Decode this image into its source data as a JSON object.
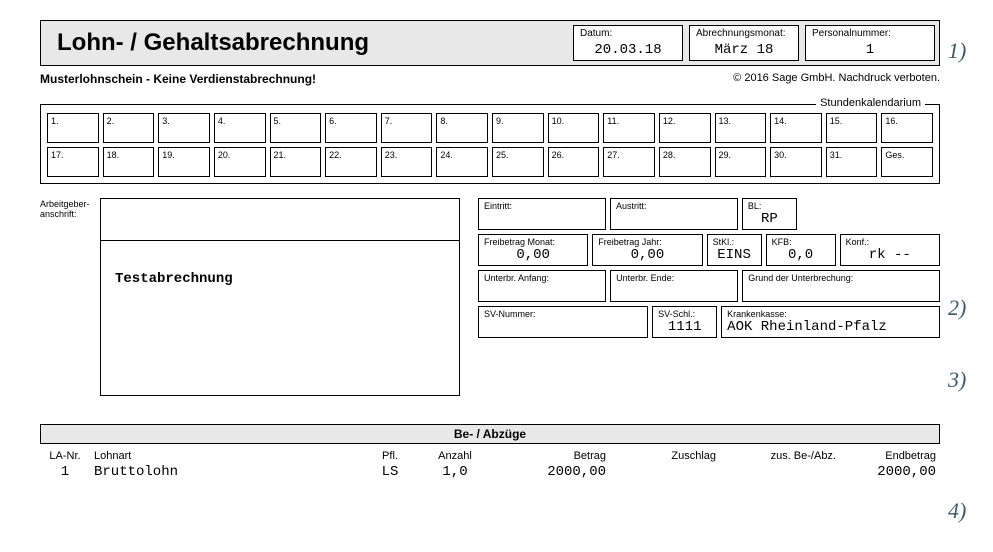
{
  "title": "Lohn- / Gehaltsabrechnung",
  "top": {
    "datum_lbl": "Datum:",
    "datum_val": "20.03.18",
    "monat_lbl": "Abrechnungsmonat:",
    "monat_val": "März 18",
    "persnr_lbl": "Personalnummer:",
    "persnr_val": "1"
  },
  "subline": {
    "muster": "Musterlohnschein - Keine Verdienstabrechnung!",
    "copy": "© 2016 Sage GmbH. Nachdruck verboten."
  },
  "cal_legend": "Stundenkalendarium",
  "cal": [
    "1.",
    "2.",
    "3.",
    "4.",
    "5.",
    "6.",
    "7.",
    "8.",
    "9.",
    "10.",
    "11.",
    "12.",
    "13.",
    "14.",
    "15.",
    "16.",
    "17.",
    "18.",
    "19.",
    "20.",
    "21.",
    "22.",
    "23.",
    "24.",
    "25.",
    "26.",
    "27.",
    "28.",
    "29.",
    "30.",
    "31.",
    "Ges."
  ],
  "arbeitgeber_lbl": "Arbeitgeber-anschrift:",
  "addr_name": "Testabrechnung",
  "r": {
    "eintritt_lbl": "Eintritt:",
    "eintritt_val": "",
    "austritt_lbl": "Austritt:",
    "austritt_val": "",
    "bl_lbl": "BL:",
    "bl_val": "RP",
    "freimonat_lbl": "Freibetrag Monat:",
    "freimonat_val": "0,00",
    "freijahr_lbl": "Freibetrag Jahr:",
    "freijahr_val": "0,00",
    "stkl_lbl": "StKl.:",
    "stkl_val": "EINS",
    "kfb_lbl": "KFB:",
    "kfb_val": "0,0",
    "konf_lbl": "Konf.:",
    "konf_val": "rk  --",
    "ua_lbl": "Unterbr. Anfang:",
    "ua_val": "",
    "ue_lbl": "Unterbr. Ende:",
    "ue_val": "",
    "grund_lbl": "Grund der Unterbrechung:",
    "grund_val": "",
    "svnr_lbl": "SV-Nummer:",
    "svnr_val": "",
    "svschl_lbl": "SV-Schl.:",
    "svschl_val": "1111",
    "kk_lbl": "Krankenkasse:",
    "kk_val": "AOK Rheinland-Pfalz"
  },
  "bezug_hdr": "Be- / Abzüge",
  "tbl_head": {
    "c1": "LA-Nr.",
    "c2": "Lohnart",
    "c3": "Pfl.",
    "c4": "Anzahl",
    "c5": "Betrag",
    "c6": "Zuschlag",
    "c7": "zus. Be-/Abz.",
    "c8": "Endbetrag"
  },
  "tbl_row": {
    "c1": "1",
    "c2": "Bruttolohn",
    "c3": "LS",
    "c4": "1,0",
    "c5": "2000,00",
    "c6": "",
    "c7": "",
    "c8": "2000,00"
  },
  "annot": {
    "a1": "1)",
    "a2": "2)",
    "a3": "3)",
    "a4": "4)"
  }
}
